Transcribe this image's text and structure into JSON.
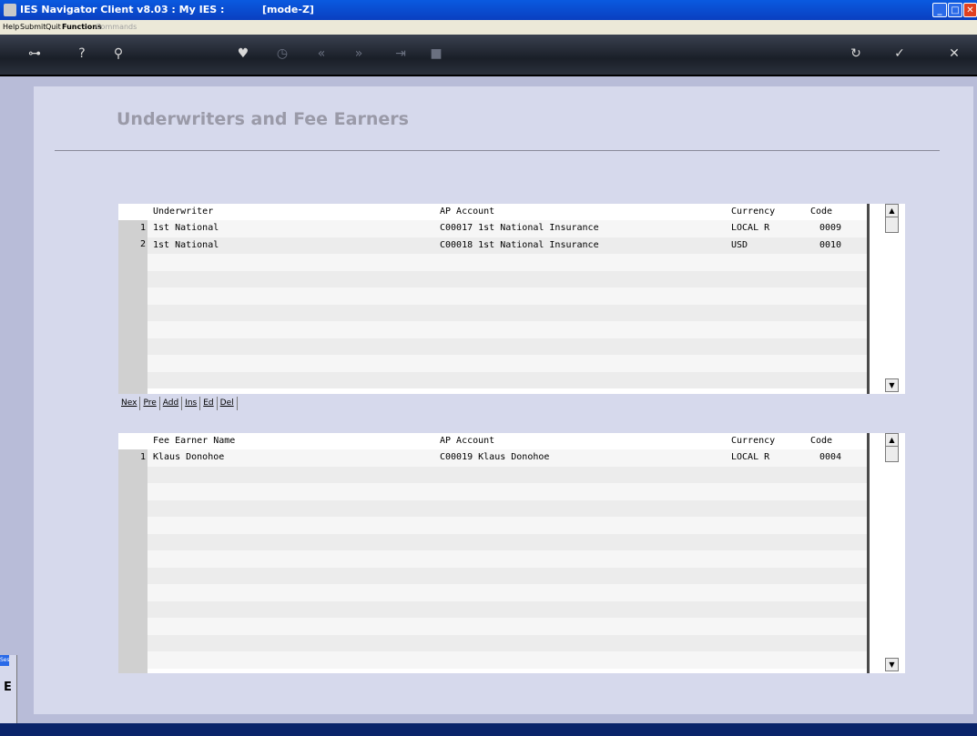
{
  "window": {
    "title": "IES Navigator Client v8.03 : My IES :",
    "mode": "[mode-Z]"
  },
  "menu": {
    "items": [
      "Help",
      "Submit",
      "Quit",
      "Functions",
      "Commands"
    ]
  },
  "toolbar": {
    "icons": [
      "key-icon",
      "help-icon",
      "search-icon",
      "heart-icon",
      "clock-icon",
      "rewind-icon",
      "fast-forward-icon",
      "end-icon",
      "stop-icon",
      "refresh-icon",
      "check-icon",
      "close-icon"
    ]
  },
  "page": {
    "heading": "Underwriters and Fee Earners"
  },
  "underwriters": {
    "headers": {
      "name": "Underwriter",
      "ap": "AP Account",
      "currency": "Currency",
      "code": "Code"
    },
    "rows": [
      {
        "num": "1",
        "name": "1st National",
        "ap": "C00017 1st National Insurance",
        "currency": "LOCAL R",
        "code": "0009"
      },
      {
        "num": "2",
        "name": "1st National",
        "ap": "C00018 1st National Insurance",
        "currency": "USD",
        "code": "0010"
      }
    ]
  },
  "buttons": {
    "items": [
      "Nex",
      "Pre",
      "Add",
      "Ins",
      "Ed",
      "Del"
    ]
  },
  "fee_earners": {
    "headers": {
      "name": "Fee Earner Name",
      "ap": "AP Account",
      "currency": "Currency",
      "code": "Code"
    },
    "rows": [
      {
        "num": "1",
        "name": "Klaus Donohoe",
        "ap": "C00019 Klaus Donohoe",
        "currency": "LOCAL R",
        "code": "0004"
      }
    ]
  },
  "side_widget": {
    "tab": "Ses",
    "letter": "E"
  }
}
